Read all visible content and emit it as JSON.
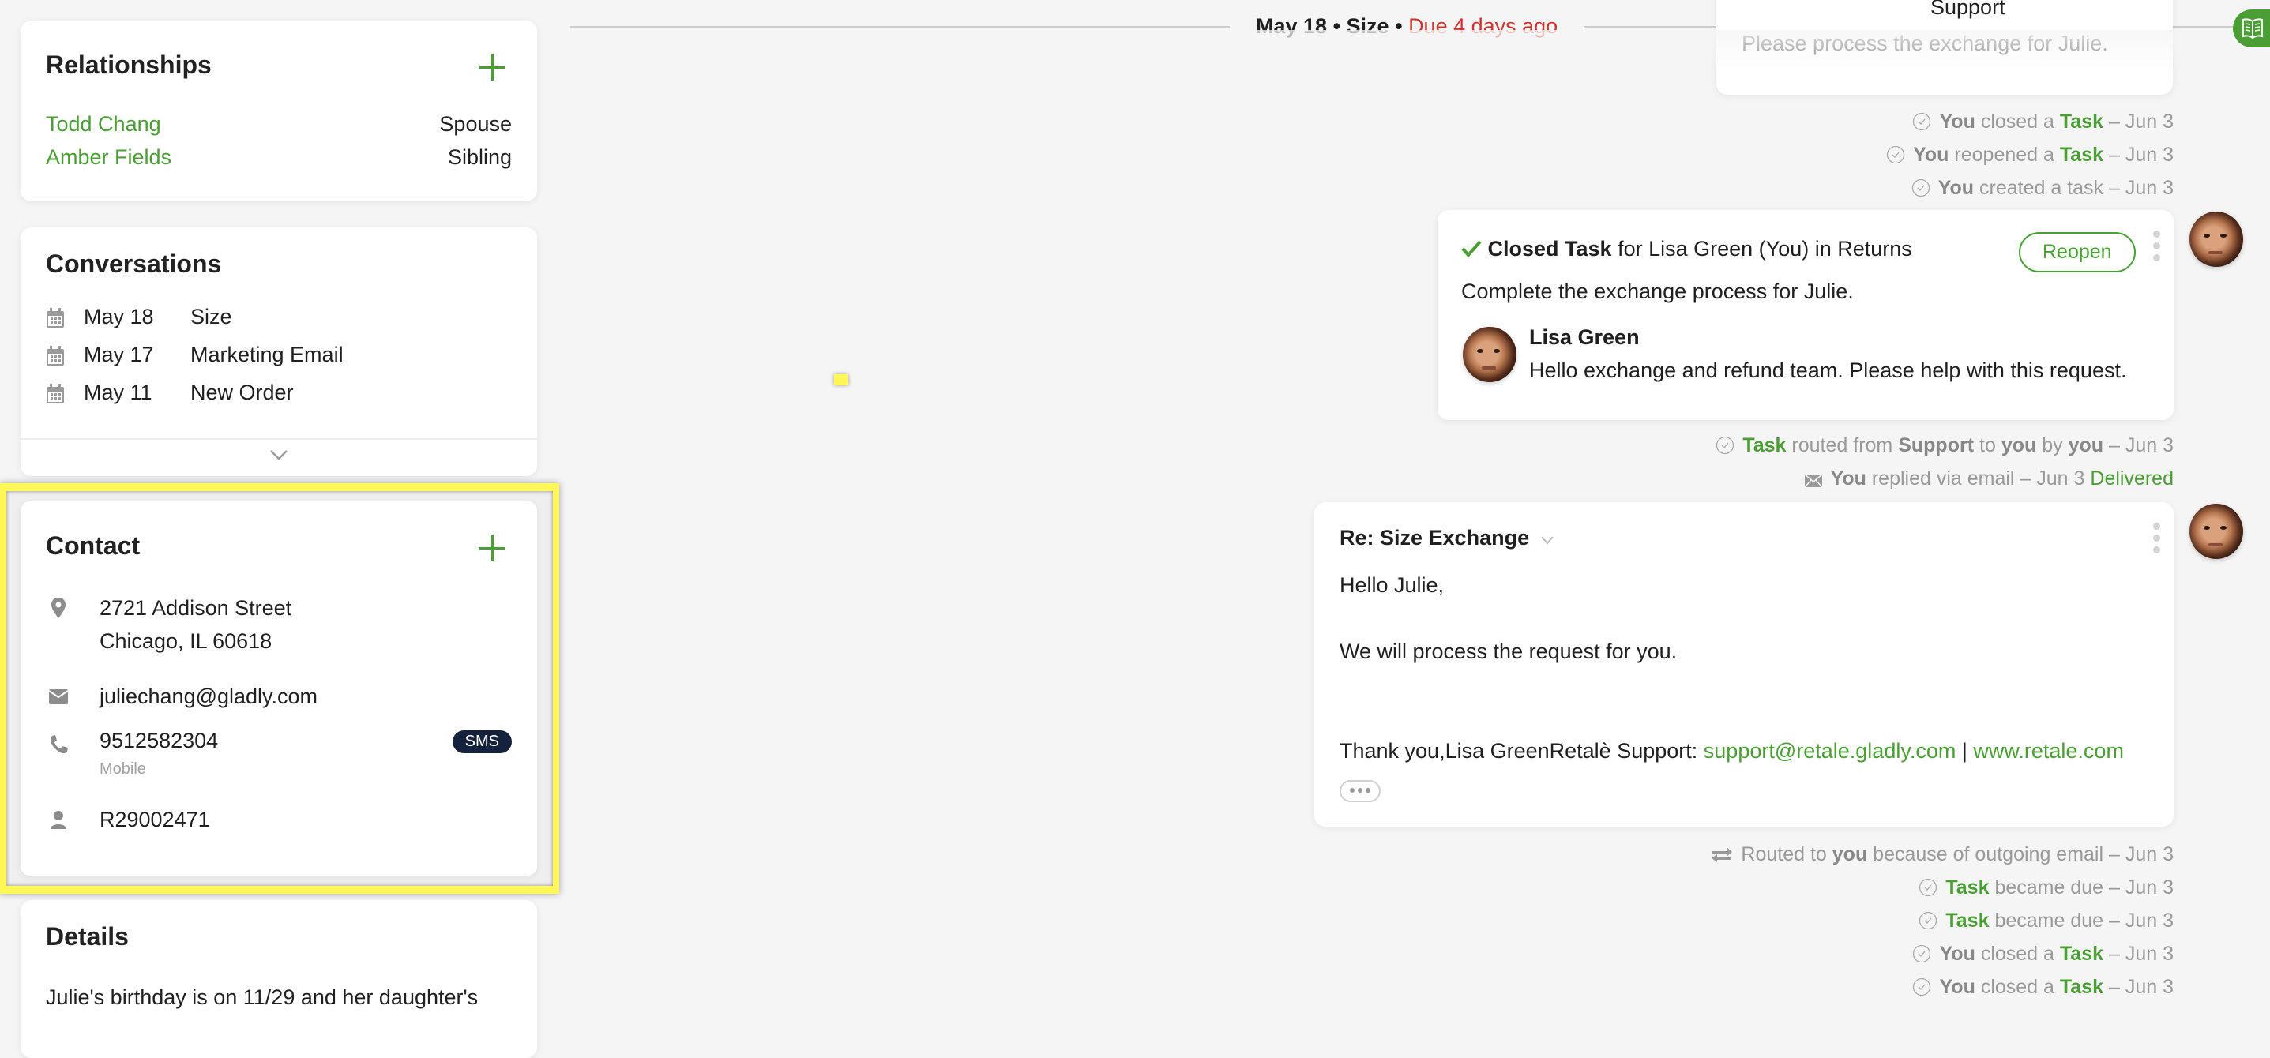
{
  "relationships": {
    "title": "Relationships",
    "add_icon": "plus-icon",
    "items": [
      {
        "name": "Todd Chang",
        "type": "Spouse"
      },
      {
        "name": "Amber Fields",
        "type": "Sibling"
      }
    ]
  },
  "conversations": {
    "title": "Conversations",
    "items": [
      {
        "date": "May 18",
        "subject": "Size"
      },
      {
        "date": "May 17",
        "subject": "Marketing Email"
      },
      {
        "date": "May 11",
        "subject": "New Order"
      }
    ],
    "expand_icon": "chevron-down-icon"
  },
  "contact": {
    "title": "Contact",
    "address_line1": "2721 Addison Street",
    "address_line2": "Chicago, IL 60618",
    "email": "juliechang@gladly.com",
    "phone": "9512582304",
    "phone_type": "Mobile",
    "sms_badge": "SMS",
    "customer_id": "R29002471"
  },
  "details": {
    "title": "Details",
    "text": "Julie's birthday is on 11/29 and her daughter's"
  },
  "feed_header": {
    "date": "May 18",
    "sep": "•",
    "topic": "Size",
    "due": "Due 4 days ago",
    "group_label": "Support"
  },
  "top_note": {
    "text": "Please process the exchange for Julie."
  },
  "events_top": [
    {
      "actor": "You",
      "mid": "closed a",
      "obj": "Task",
      "date": "– Jun 3"
    },
    {
      "actor": "You",
      "mid": "reopened a",
      "obj": "Task",
      "date": "– Jun 3"
    },
    {
      "actor": "You",
      "mid": "created a task",
      "obj": "",
      "date": "– Jun 3"
    }
  ],
  "task_card": {
    "status": "Closed Task",
    "for_text": "for Lisa Green (You) in Returns",
    "reopen_label": "Reopen",
    "description": "Complete the exchange process for Julie.",
    "comment_author": "Lisa Green",
    "comment_text": "Hello exchange and refund team. Please help with this request."
  },
  "event_routed": {
    "task": "Task",
    "t1": "routed from",
    "from": "Support",
    "t2": "to",
    "to": "you",
    "t3": "by",
    "by": "you",
    "date": "– Jun 3"
  },
  "event_replied": {
    "actor": "You",
    "text": "replied via email – Jun 3",
    "status": "Delivered"
  },
  "email_card": {
    "subject": "Re: Size Exchange",
    "greeting": "Hello Julie,",
    "body": "We will process the request for you.",
    "signature": "Thank you,Lisa GreenRetalè Support: ",
    "sig_email": "support@retale.gladly.com",
    "sig_sep": " | ",
    "sig_web": "www.retale.com"
  },
  "events_bottom": {
    "routed": {
      "pre": "Routed to",
      "who": "you",
      "post": "because of outgoing email – Jun 3"
    },
    "items": [
      {
        "actor": "",
        "obj": "Task",
        "text": "became due – Jun 3"
      },
      {
        "actor": "",
        "obj": "Task",
        "text": "became due – Jun 3"
      },
      {
        "actor": "You",
        "mid": "closed a",
        "obj": "Task",
        "text": "– Jun 3"
      },
      {
        "actor": "You",
        "mid": "closed a",
        "obj": "Task",
        "text": "– Jun 3"
      }
    ]
  },
  "colors": {
    "accent": "#4a9e35",
    "due": "#d0312d",
    "badge": "#14223d",
    "highlight": "#fff757"
  }
}
